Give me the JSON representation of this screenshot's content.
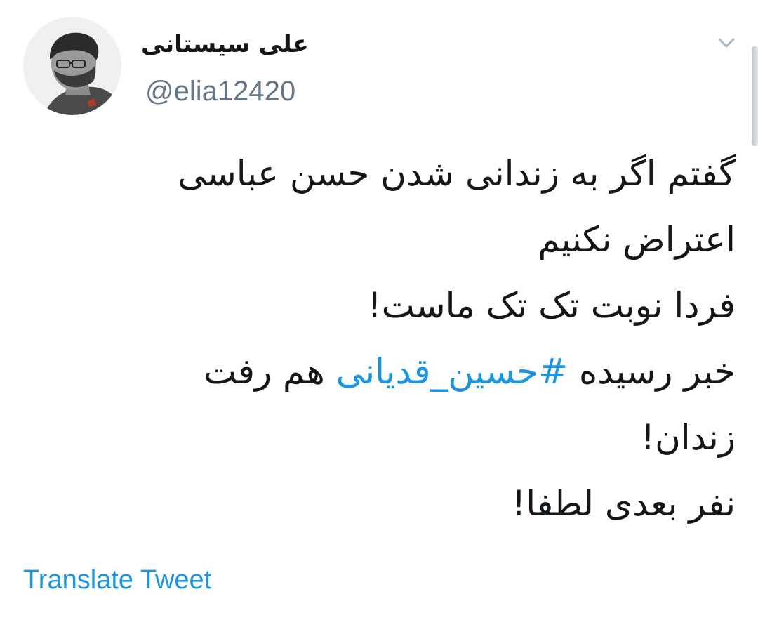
{
  "author": {
    "display_name": "علی سیستانی",
    "handle": "@elia12420",
    "avatar_icon": "profile-photo"
  },
  "menu": {
    "icon": "chevron-down-icon"
  },
  "tweet": {
    "line1": "گفتم اگر به زندانی شدن حسن عباسی",
    "line2": "اعتراض نکنیم",
    "line3": "فردا نوبت تک تک ماست!",
    "line4_before": "خبر رسیده ",
    "line4_hashtag": "#حسین_قدیانی",
    "line4_after": " هم رفت",
    "line5": "زندان!",
    "line6": "نفر بعدی لطفا!"
  },
  "actions": {
    "translate_label": "Translate Tweet"
  },
  "colors": {
    "text": "#14171a",
    "secondary": "#657786",
    "link": "#1b95e0"
  }
}
